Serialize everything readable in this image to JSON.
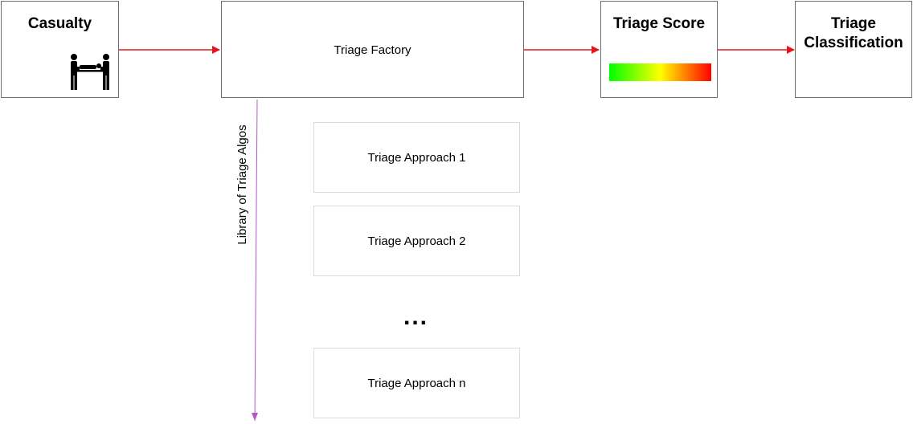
{
  "casualty": {
    "title": "Casualty",
    "icon": "stretcher-carriers-icon"
  },
  "factory": {
    "label": "Triage Factory"
  },
  "score": {
    "title": "Triage Score",
    "bar_colors": [
      "#00ff00",
      "#ffff00",
      "#ff0000"
    ]
  },
  "classification": {
    "title_line1": "Triage",
    "title_line2": "Classification"
  },
  "library": {
    "label": "Library of Triage Algos"
  },
  "approaches": [
    "Triage Approach 1",
    "Triage Approach 2",
    "Triage Approach n"
  ],
  "ellipsis": "...",
  "colors": {
    "arrow": "#e8141c",
    "library_arrow": "#b455c8"
  }
}
